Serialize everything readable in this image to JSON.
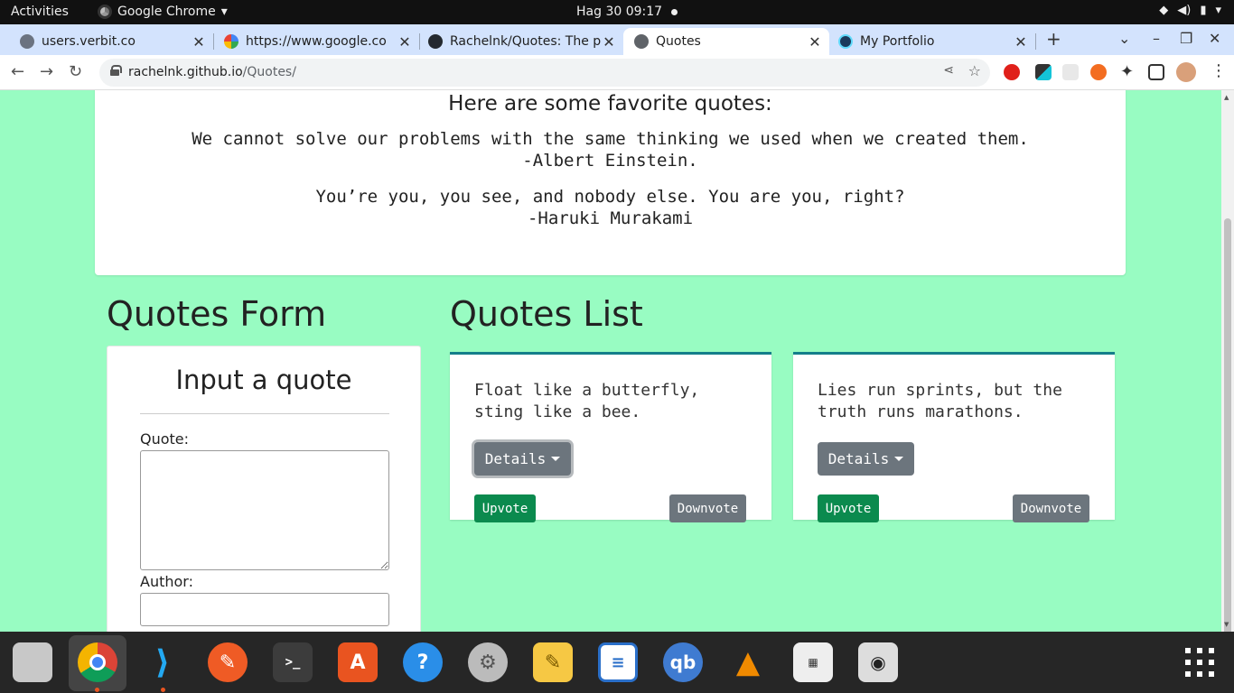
{
  "system_bar": {
    "activities": "Activities",
    "app_name": "Google Chrome",
    "clock": "Hag 30  09:17"
  },
  "browser": {
    "tabs": [
      {
        "label": "users.verbit.co",
        "favicon": "globe-icon"
      },
      {
        "label": "https://www.google.co",
        "favicon": "google-icon"
      },
      {
        "label": "Rachelnk/Quotes: The p",
        "favicon": "github-icon"
      },
      {
        "label": "Quotes",
        "favicon": "globe-icon",
        "active": true
      },
      {
        "label": "My Portfolio",
        "favicon": "react-icon"
      }
    ],
    "url_host": "rachelnk.github.io",
    "url_path": "/Quotes/"
  },
  "favorites": {
    "title": "Here are some favorite quotes:",
    "quotes": [
      {
        "text": "We cannot solve our problems with the same thinking we used when we created them.",
        "author": "-Albert Einstein."
      },
      {
        "text": "You’re you, you see, and nobody else. You are you, right?",
        "author": "-Haruki Murakami"
      }
    ]
  },
  "form": {
    "section_title": "Quotes Form",
    "heading": "Input a quote",
    "quote_label": "Quote:",
    "quote_value": "",
    "author_label": "Author:",
    "author_value": ""
  },
  "list": {
    "section_title": "Quotes List",
    "cards": [
      {
        "text": "Float like a butterfly, sting like a bee.",
        "details_label": "Details",
        "upvote_label": "Upvote",
        "downvote_label": "Downvote"
      },
      {
        "text": "Lies run sprints, but the truth runs marathons.",
        "details_label": "Details",
        "upvote_label": "Upvote",
        "downvote_label": "Downvote"
      }
    ]
  },
  "dock": {
    "apps": [
      "files-icon",
      "chrome-icon",
      "vscode-icon",
      "postman-icon",
      "terminal-icon",
      "software-center-icon",
      "help-icon",
      "settings-icon",
      "text-editor-icon",
      "writer-icon",
      "qbittorrent-icon",
      "vlc-icon",
      "sudoku-icon",
      "ipod-icon"
    ],
    "grid_label": "show-applications-icon"
  },
  "colors": {
    "page_bg": "#98fcc2",
    "card_accent": "#147e8a",
    "upvote": "#0b8a4e",
    "secondary": "#6c757d"
  }
}
